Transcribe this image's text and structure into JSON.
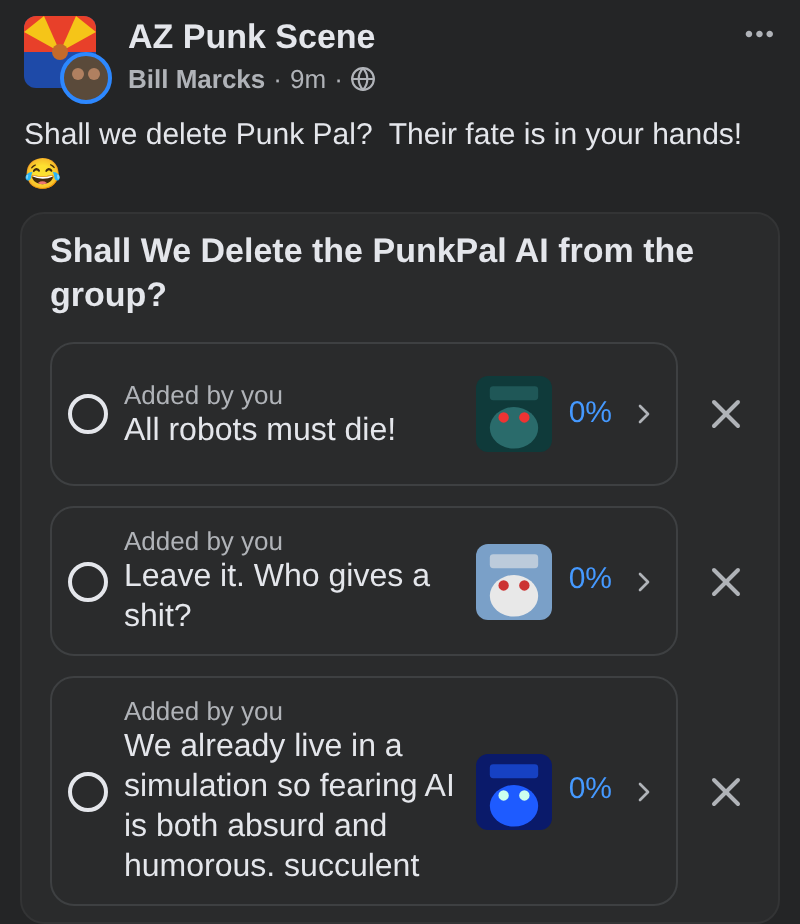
{
  "post": {
    "group": "AZ Punk Scene",
    "author": "Bill Marcks",
    "time": "9m",
    "separator": "·",
    "more": "•••",
    "text": "Shall we delete Punk Pal?  Their fate is in your hands!",
    "emoji": "😂"
  },
  "poll": {
    "title": "Shall We Delete the PunkPal AI from the group?",
    "options": [
      {
        "added_by": "Added by you",
        "label": "All robots must die!",
        "selected": false,
        "percent": "0%"
      },
      {
        "added_by": "Added by you",
        "label": "Leave it. Who gives a shit?",
        "selected": false,
        "percent": "0%"
      },
      {
        "added_by": "Added by you",
        "label": "We already live in a simulation so fearing AI is both absurd and humorous. succulent",
        "selected": false,
        "percent": "0%"
      }
    ]
  }
}
